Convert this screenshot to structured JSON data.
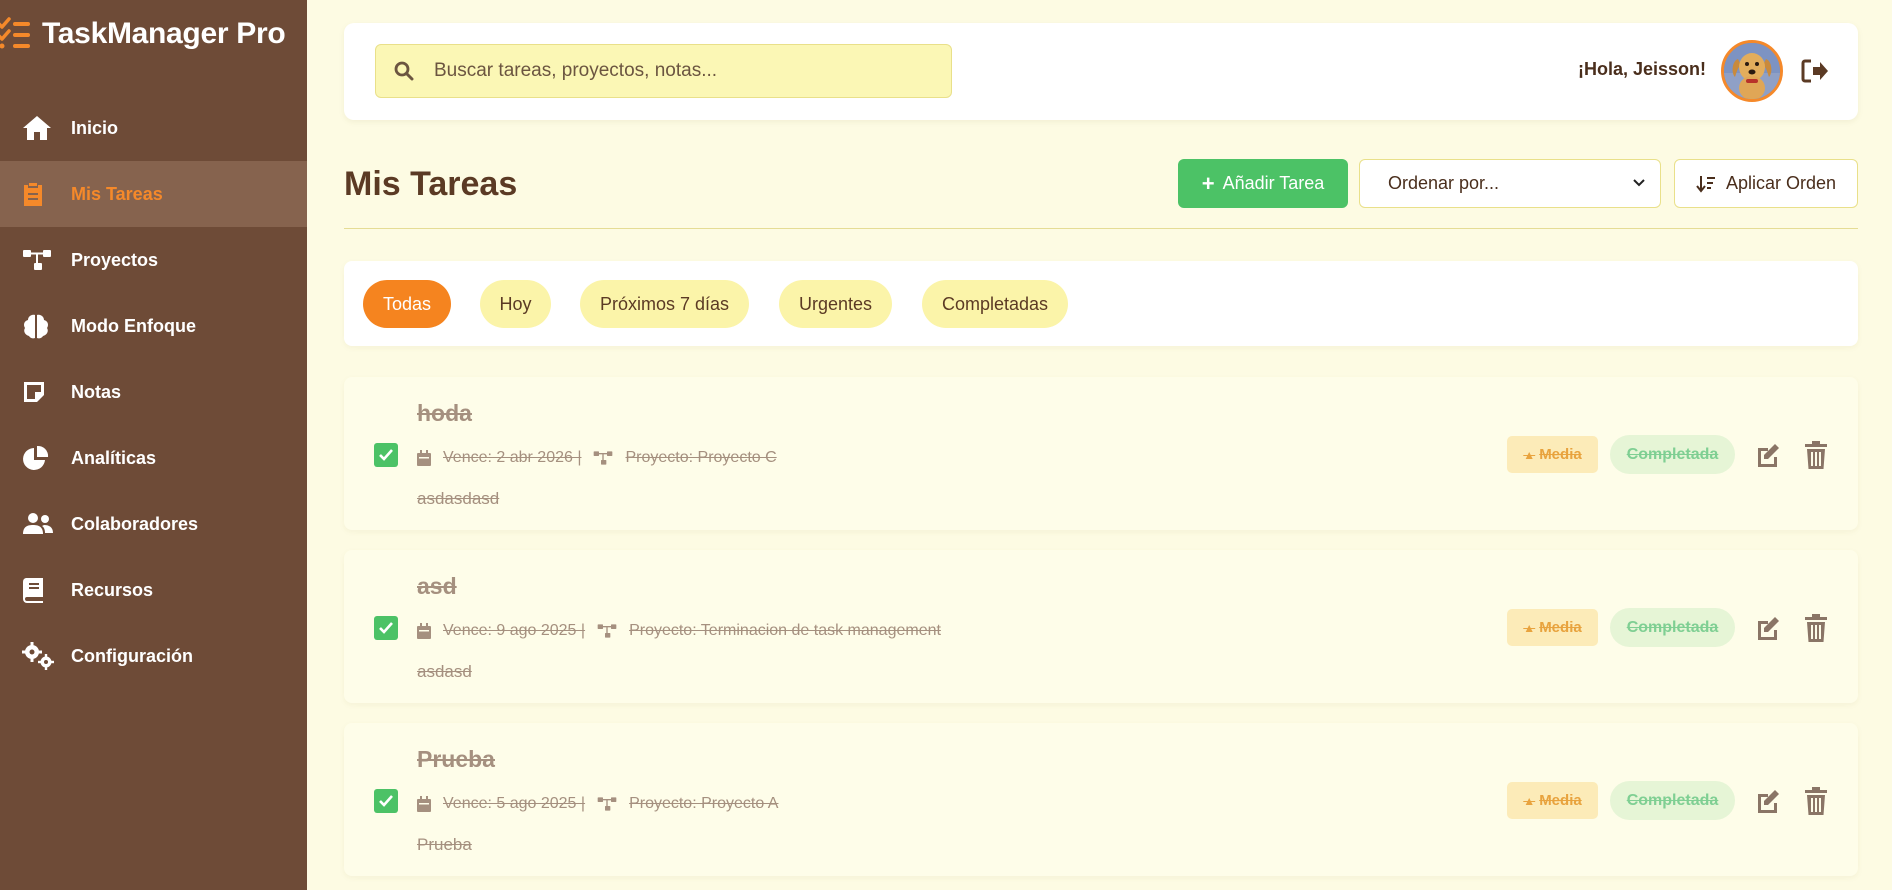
{
  "app": {
    "title": "TaskManager Pro",
    "colors": {
      "sidebar": "#6e4b37",
      "accent": "#f5892a",
      "success": "#4cc266",
      "background": "#fdfbe3"
    }
  },
  "sidebar": {
    "items": [
      {
        "label": "Inicio",
        "icon": "home-icon"
      },
      {
        "label": "Mis Tareas",
        "icon": "clipboard-icon",
        "active": true
      },
      {
        "label": "Proyectos",
        "icon": "project-tree-icon"
      },
      {
        "label": "Modo Enfoque",
        "icon": "brain-icon"
      },
      {
        "label": "Notas",
        "icon": "note-icon"
      },
      {
        "label": "Analíticas",
        "icon": "pie-chart-icon"
      },
      {
        "label": "Colaboradores",
        "icon": "users-icon"
      },
      {
        "label": "Recursos",
        "icon": "book-icon"
      },
      {
        "label": "Configuración",
        "icon": "cogs-icon"
      }
    ]
  },
  "topbar": {
    "search_placeholder": "Buscar tareas, proyectos, notas...",
    "greeting": "¡Hola, Jeisson!"
  },
  "main": {
    "title": "Mis Tareas",
    "add_task_label": "Añadir Tarea",
    "sort_placeholder": "Ordenar por...",
    "apply_sort_label": "Aplicar Orden",
    "filters": [
      {
        "label": "Todas",
        "active": true
      },
      {
        "label": "Hoy"
      },
      {
        "label": "Próximos 7 días"
      },
      {
        "label": "Urgentes"
      },
      {
        "label": "Completadas"
      }
    ],
    "tasks": [
      {
        "title": "hoda",
        "due": "Vence: 2 abr 2026 |",
        "project": "Proyecto: Proyecto C",
        "description": "asdasdasd",
        "priority": "Media",
        "status": "Completada",
        "checked": true
      },
      {
        "title": "asd",
        "due": "Vence: 9 ago 2025 |",
        "project": "Proyecto: Terminacion de task management",
        "description": "asdasd",
        "priority": "Media",
        "status": "Completada",
        "checked": true
      },
      {
        "title": "Prueba",
        "due": "Vence: 5 ago 2025 |",
        "project": "Proyecto: Proyecto A",
        "description": "Prueba",
        "priority": "Media",
        "status": "Completada",
        "checked": true
      }
    ]
  }
}
